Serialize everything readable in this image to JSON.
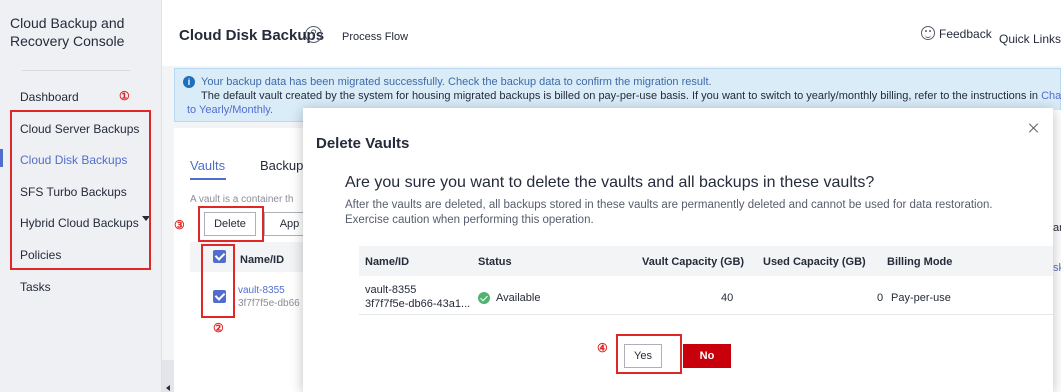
{
  "sidebar": {
    "title": "Cloud Backup and Recovery Console",
    "items": [
      {
        "label": "Dashboard"
      },
      {
        "label": "Cloud Server Backups"
      },
      {
        "label": "Cloud Disk Backups"
      },
      {
        "label": "SFS Turbo Backups"
      },
      {
        "label": "Hybrid Cloud Backups"
      },
      {
        "label": "Policies"
      },
      {
        "label": "Tasks"
      }
    ]
  },
  "header": {
    "title": "Cloud Disk Backups",
    "help": "?",
    "process_flow": "Process Flow",
    "feedback": "Feedback",
    "quick_links": "Quick Links"
  },
  "banner": {
    "line1": "Your backup data has been migrated successfully. Check the backup data to confirm the migration result.",
    "line2": "The default vault created by the system for housing migrated backups is billed on pay-per-use basis. If you want to switch to yearly/monthly billing, refer to the instructions in ",
    "link_start": "Changing I",
    "link_end": "to Yearly/Monthly."
  },
  "main": {
    "tabs": [
      "Vaults",
      "Backups"
    ],
    "description": "A vault is a container th",
    "buttons": {
      "delete": "Delete",
      "apply": "App"
    },
    "right_fragment": "ar",
    "right_fragment2": "sk",
    "table": {
      "header_name": "Name/ID",
      "rows": [
        {
          "name": "vault-8355",
          "id": "3f7f7f5e-db66"
        }
      ]
    }
  },
  "annotations": {
    "n1": "①",
    "n2": "②",
    "n3": "③",
    "n4": "④"
  },
  "dialog": {
    "title": "Delete Vaults",
    "question": "Are you sure you want to delete the vaults and all backups in these vaults?",
    "warning": "After the vaults are deleted, all backups stored in these vaults are permanently deleted and cannot be used for data restoration. Exercise caution when performing this operation.",
    "columns": [
      "Name/ID",
      "Status",
      "Vault Capacity (GB)",
      "Used Capacity (GB)",
      "Billing Mode"
    ],
    "row": {
      "name": "vault-8355",
      "id": "3f7f7f5e-db66-43a1...",
      "status": "Available",
      "vault_capacity": "40",
      "used_capacity": "0",
      "billing_mode": "Pay-per-use"
    },
    "yes": "Yes",
    "no": "No"
  },
  "colors": {
    "accent": "#526ecc",
    "danger": "#c7000b",
    "annotation": "#e02727",
    "available": "#50b370"
  }
}
